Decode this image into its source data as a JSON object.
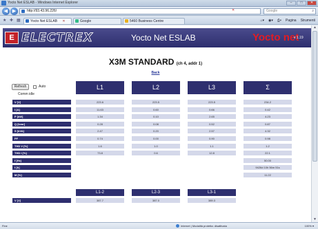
{
  "browser": {
    "window_title": "Yocto Net ESLAB - Windows Internet Explorer",
    "url": "http://93.43.96.226/",
    "search_placeholder": "Google",
    "tabs": [
      {
        "label": "Yocto Net ESLAB",
        "active": true
      },
      {
        "label": "Google",
        "active": false
      },
      {
        "label": "5460 Business Centre",
        "active": false
      }
    ],
    "command_items": [
      "Pagina",
      "Strumenti"
    ],
    "status_left": "Fine",
    "status_zone": "Internet | Modalità protetta: disattivata",
    "status_zoom": "100%"
  },
  "banner": {
    "logo_text": "ELECTREX",
    "product": "Yocto Net ESLAB",
    "brand": "Yocto net",
    "version": "v 1.19"
  },
  "page": {
    "title": "X3M STANDARD",
    "subtitle": "(ch 4, addr 1)",
    "back_link": "Back",
    "refresh_label": "Refresh",
    "auto_label": "Auto",
    "conn_label": "Comm idle"
  },
  "table": {
    "headers": [
      "L1",
      "L2",
      "L3",
      "Σ"
    ],
    "rows": [
      {
        "label": "V [V]",
        "values": [
          "223.6",
          "223.5",
          "223.5",
          "234.2"
        ]
      },
      {
        "label": "I [A]",
        "values": [
          "11.63",
          "0.60",
          "0.66",
          "0.42"
        ]
      },
      {
        "label": "P [kW]",
        "values": [
          "1.34",
          "0.10",
          "2.65",
          "4.23"
        ]
      },
      {
        "label": "Q [kvar]",
        "values": [
          "0.28",
          "0.08",
          "0.52",
          "0.87"
        ]
      },
      {
        "label": "S [kVA]",
        "values": [
          "2.47",
          "0.20",
          "2.57",
          "4.32"
        ]
      },
      {
        "label": "PF",
        "values": [
          "0.74",
          "0.00",
          "0.90",
          "0.98"
        ]
      },
      {
        "label": "THD V [%]",
        "values": [
          "1.6",
          "1.0",
          "1.1",
          "1.2"
        ]
      },
      {
        "label": "THD I [%]",
        "values": [
          "73.8",
          "0.6",
          "12.8",
          "22.1"
        ]
      },
      {
        "label": "f [Hz]",
        "values": [
          "",
          "",
          "",
          "50.00"
        ]
      },
      {
        "label": "t [h]",
        "values": [
          "",
          "",
          "",
          "9426d 10h 56m 51s"
        ]
      },
      {
        "label": "M [%]",
        "values": [
          "",
          "",
          "",
          "11.22"
        ]
      }
    ],
    "headers2": [
      "L1-2",
      "L2-3",
      "L3-1"
    ],
    "rows2": [
      {
        "label": "V [V]",
        "values": [
          "387.7",
          "387.0",
          "389.3"
        ]
      }
    ]
  }
}
